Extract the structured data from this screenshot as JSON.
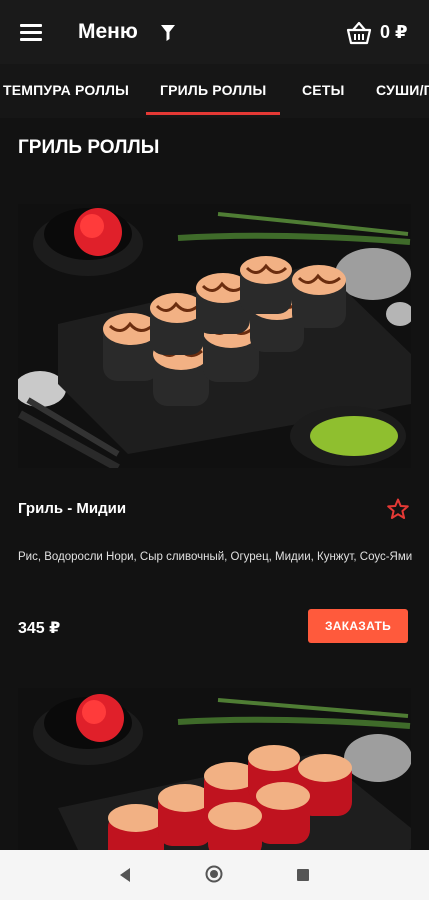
{
  "topbar": {
    "title": "Меню",
    "cart_total": "0 ₽"
  },
  "tabs": [
    {
      "label": "ТЕМПУРА РОЛЛЫ"
    },
    {
      "label": "ГРИЛЬ РОЛЛЫ",
      "active": true
    },
    {
      "label": "СЕТЫ"
    },
    {
      "label": "СУШИ/Г"
    }
  ],
  "section": {
    "title": "ГРИЛЬ РОЛЛЫ"
  },
  "products": [
    {
      "name": "Гриль - Мидии",
      "description": "Рис, Водоросли Нори, Сыр сливочный, Огурец, Мидии, Кунжут, Соус-Ями",
      "price": "345 ₽",
      "order_label": "ЗАКАЗАТЬ"
    }
  ],
  "colors": {
    "accent": "#e53935",
    "button": "#ff5a3c",
    "background": "#121212"
  },
  "icons": [
    "menu-icon",
    "filter-icon",
    "basket-icon",
    "star-outline-icon",
    "back-icon",
    "home-icon",
    "recent-apps-icon"
  ]
}
